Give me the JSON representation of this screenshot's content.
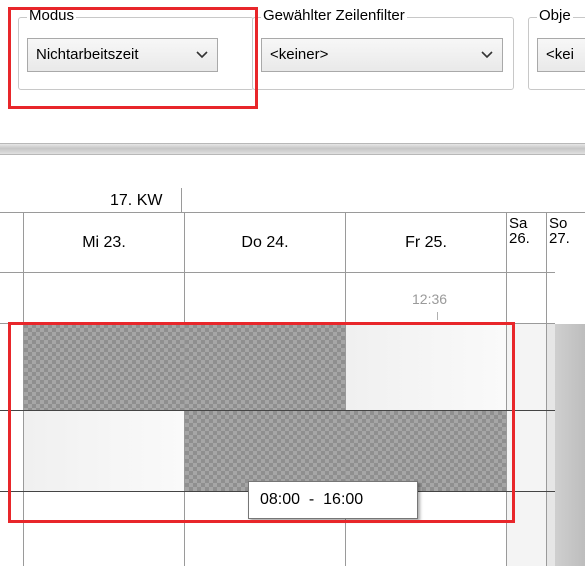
{
  "toolbar": {
    "modus": {
      "legend": "Modus",
      "value": "Nichtarbeitszeit"
    },
    "zeilenfilter": {
      "legend": "Gewählter Zeilenfilter",
      "value": "<keiner>"
    },
    "objekt": {
      "legend": "Obje",
      "value": "<kei"
    }
  },
  "calendar": {
    "week_label": "17. KW",
    "days": [
      {
        "label": "Mi 23."
      },
      {
        "label": "Do 24."
      },
      {
        "label": "Fr 25."
      }
    ],
    "weekend": [
      {
        "line1": "Sa",
        "line2": "26."
      },
      {
        "line1": "So",
        "line2": "27."
      }
    ],
    "time_marker": "12:36",
    "tooltip": "08:00  -  16:00"
  },
  "colors": {
    "highlight": "#e8262a",
    "hatch": "#8f8f8f"
  }
}
